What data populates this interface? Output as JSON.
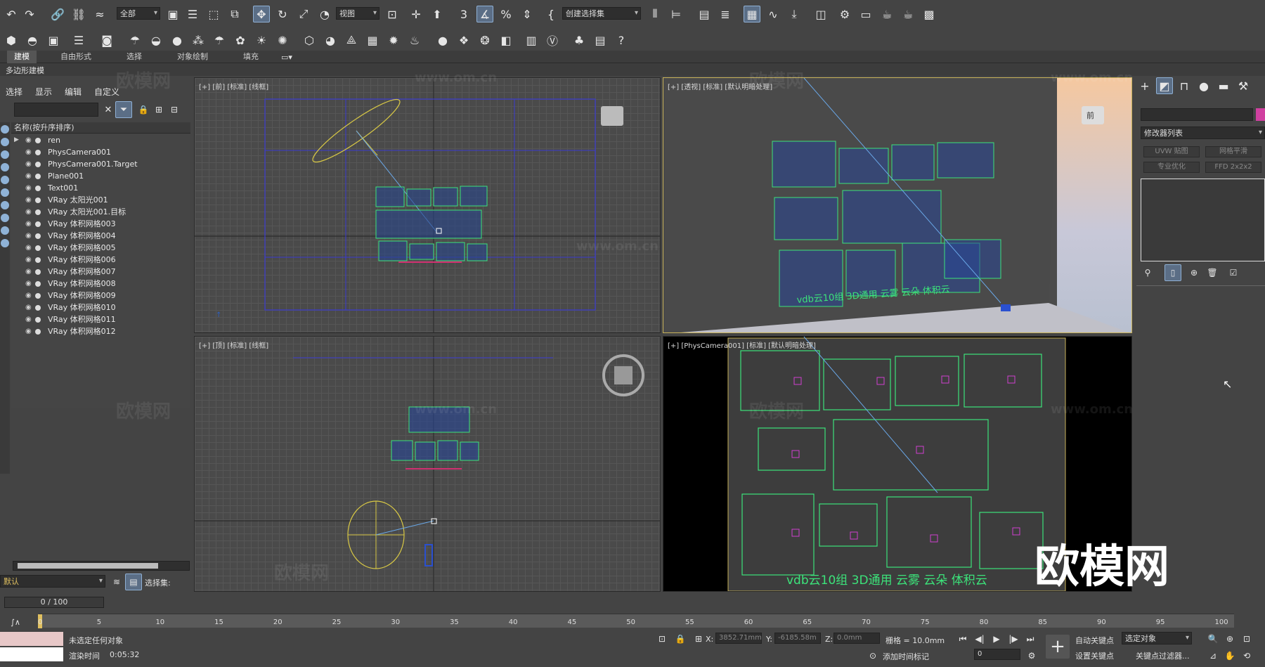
{
  "toolbar": {
    "selection_filter": "全部",
    "ref_coord": "视图",
    "named_selection": "创建选择集"
  },
  "ribbon": {
    "tabs": [
      "建模",
      "自由形式",
      "选择",
      "对象绘制",
      "填充"
    ],
    "sub_label": "多边形建模"
  },
  "scene_explorer": {
    "menu": [
      "选择",
      "显示",
      "编辑",
      "自定义"
    ],
    "column_header": "名称(按升序排序)",
    "items": [
      "ren",
      "PhysCamera001",
      "PhysCamera001.Target",
      "Plane001",
      "Text001",
      "VRay 太阳光001",
      "VRay 太阳光001.目标",
      "VRay 体积网格003",
      "VRay 体积网格004",
      "VRay 体积网格005",
      "VRay 体积网格006",
      "VRay 体积网格007",
      "VRay 体积网格008",
      "VRay 体积网格009",
      "VRay 体积网格010",
      "VRay 体积网格011",
      "VRay 体积网格012"
    ],
    "layer_name": "默认",
    "selection_set_label": "选择集:"
  },
  "viewports": {
    "front_label": "[+] [前] [标准] [线框]",
    "persp_label": "[+] [透视] [标准] [默认明暗处理]",
    "top_label": "[+] [顶] [标准] [线框]",
    "camera_label": "[+] [PhysCamera001] [标准] [默认明暗处理]",
    "viewcube_front": "前",
    "scene_text": "vdb云10组 3D通用 云雾 云朵 体积云"
  },
  "watermark": {
    "brand": "欧模网",
    "url": "www.om.cn"
  },
  "command_panel": {
    "modifier_list": "修改器列表",
    "btn_uvw": "UVW 贴图",
    "btn_meshsmooth": "网格平滑",
    "btn_optimize": "专业优化",
    "btn_ffd": "FFD 2x2x2"
  },
  "timeline": {
    "frame_display": "0 / 100",
    "ticks": [
      "0",
      "5",
      "10",
      "15",
      "20",
      "25",
      "30",
      "35",
      "40",
      "45",
      "50",
      "55",
      "60",
      "65",
      "70",
      "75",
      "80",
      "85",
      "90",
      "95",
      "100"
    ]
  },
  "status": {
    "selection_msg": "未选定任何对象",
    "render_time_label": "渲染时间",
    "render_time": "0:05:32",
    "x_label": "X:",
    "x_value": "3852.71mm",
    "y_label": "Y:",
    "y_value": "-6185.58m",
    "z_label": "Z:",
    "z_value": "0.0mm",
    "grid_label": "栅格 = 10.0mm",
    "add_time_tag": "添加时间标记",
    "auto_key": "自动关键点",
    "set_key": "设置关键点",
    "selected_object": "选定对象",
    "key_filters": "关键点过滤器...",
    "frame_input": "0"
  }
}
